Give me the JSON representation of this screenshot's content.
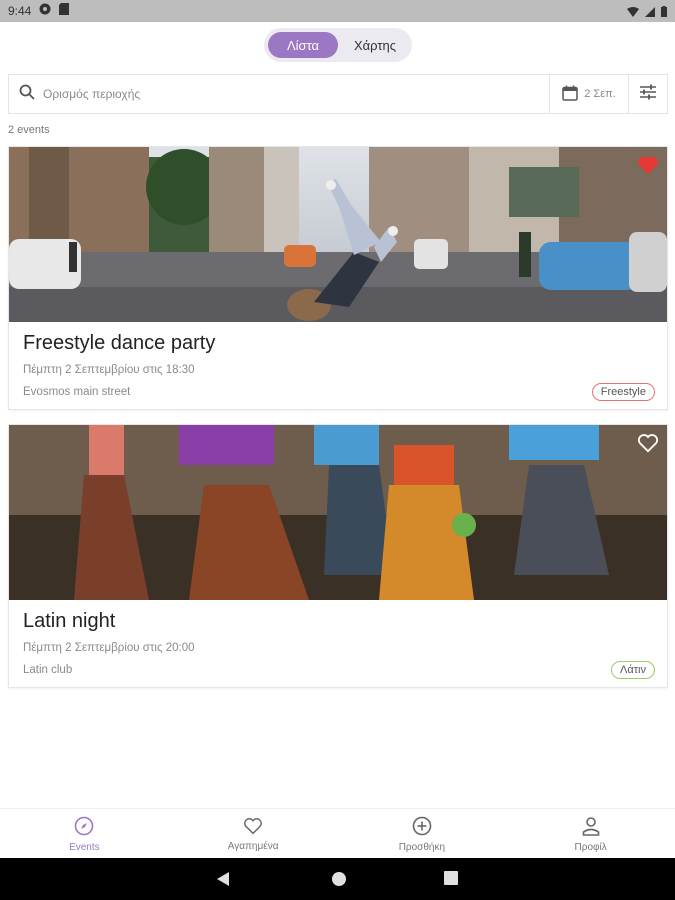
{
  "status_bar": {
    "time": "9:44"
  },
  "view_toggle": {
    "list_label": "Λίστα",
    "map_label": "Χάρτης"
  },
  "search": {
    "placeholder": "Ορισμός περιοχής",
    "date_label": "2 Σεπ."
  },
  "events_count": "2 events",
  "events": [
    {
      "title": "Freestyle dance party",
      "date": "Πέμπτη 2 Σεπτεμβρίου στις 18:30",
      "place": "Evosmos main street",
      "tag": "Freestyle",
      "tag_color": "#e57373",
      "favorite": true
    },
    {
      "title": "Latin night",
      "date": "Πέμπτη 2 Σεπτεμβρίου στις 20:00",
      "place": "Latin club",
      "tag": "Λάτιν",
      "tag_color": "#9ccc65",
      "favorite": false
    }
  ],
  "bottom_nav": {
    "events": "Events",
    "favorites": "Αγαπημένα",
    "add": "Προσθήκη",
    "profile": "Προφίλ"
  },
  "colors": {
    "accent": "#9c77c4",
    "fav_active": "#e53935"
  }
}
